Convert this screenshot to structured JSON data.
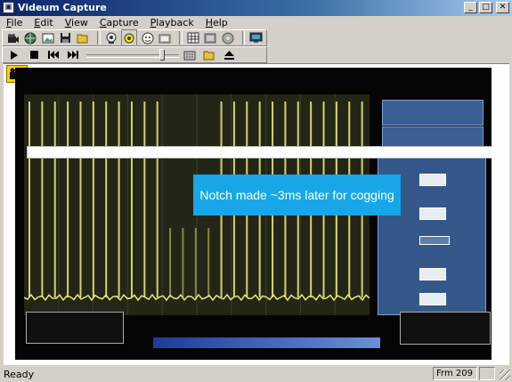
{
  "window": {
    "title": "Videum Capture",
    "min_glyph": "_",
    "max_glyph": "□",
    "close_glyph": "✕"
  },
  "menu": [
    {
      "label": "File",
      "accel": "F",
      "rest": "ile"
    },
    {
      "label": "Edit",
      "accel": "E",
      "rest": "dit"
    },
    {
      "label": "View",
      "accel": "V",
      "rest": "iew"
    },
    {
      "label": "Capture",
      "accel": "C",
      "rest": "apture"
    },
    {
      "label": "Playback",
      "accel": "P",
      "rest": "layback"
    },
    {
      "label": "Help",
      "accel": "H",
      "rest": "elp"
    }
  ],
  "toolbar_icons": [
    "camera-icon",
    "globe-icon",
    "image-icon",
    "save-icon",
    "open-folder-icon",
    "webcam-icon",
    "record-icon",
    "face-icon",
    "tv-icon",
    "grid-icon",
    "film-icon",
    "disc-icon",
    "screen-icon"
  ],
  "playback_icons": [
    "play-icon",
    "stop-icon",
    "rewind-icon",
    "fast-forward-icon",
    "keyboard-icon",
    "open-folder-icon",
    "eject-icon"
  ],
  "slider": {
    "position_fraction": 0.84
  },
  "video": {
    "callout": "Notch made ~3ms later for cogging",
    "pulse_count": 27
  },
  "status": {
    "text": "Ready",
    "frame": "Frm 209"
  },
  "colors": {
    "accent": "#17a7e8",
    "scope_trace": "#e6e67a",
    "titlebar": "#0a246a"
  }
}
